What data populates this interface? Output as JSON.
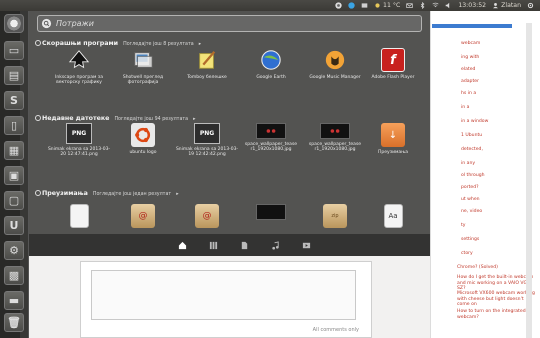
{
  "panel": {
    "temperature": "11 °C",
    "time": "13:03:52",
    "user": "Zlatan"
  },
  "search": {
    "placeholder": "Потражи"
  },
  "sections": {
    "recent_apps": {
      "title": "Скорашњи програми",
      "subtitle": "Погледајте још 8 резултата",
      "items": [
        {
          "label": "Inkscape програм за векторску графику",
          "icon": "inkscape-icon"
        },
        {
          "label": "Shotwell преглед фотографија",
          "icon": "shotwell-icon"
        },
        {
          "label": "Tomboy белешке",
          "icon": "tomboy-notes-icon"
        },
        {
          "label": "Google Earth",
          "icon": "google-earth-icon"
        },
        {
          "label": "Google Music Manager",
          "icon": "google-music-manager-icon"
        },
        {
          "label": "Adobe Flash Player",
          "icon": "flash-player-icon"
        }
      ]
    },
    "recent_files": {
      "title": "Недавне датотеке",
      "subtitle": "Погледајте још 94 резултата",
      "items": [
        {
          "label": "Snimak ekrana sa 2013-03-20 12:47:41.png",
          "icon": "png-file-icon",
          "thumb": "PNG"
        },
        {
          "label": "ubuntu logo",
          "icon": "ubuntu-logo-icon",
          "thumb": ""
        },
        {
          "label": "Snimak ekrana sa 2013-03-19 12:42:42.png",
          "icon": "png-file-icon",
          "thumb": "PNG"
        },
        {
          "label": "space_wallpaper_tease r1_1920x1080.jpg",
          "icon": "wallpaper-thumb-icon",
          "thumb": ""
        },
        {
          "label": "space_wallpaper_tease r1_1920x1080.jpg",
          "icon": "wallpaper-thumb-icon",
          "thumb": ""
        },
        {
          "label": "Преузимања",
          "icon": "downloads-folder-icon",
          "thumb": ""
        }
      ]
    },
    "downloads": {
      "title": "Преузимања",
      "subtitle": "Погледајте још један резултат"
    }
  },
  "browser": {
    "footer": "All comments only",
    "sidebar_links": [
      "webcam",
      "ing with",
      "elated",
      "adapter",
      "hs in a",
      "in a",
      "in a window",
      "1 Ubuntu",
      "detected,",
      "in any",
      "ol through",
      "ported?",
      "ut when",
      "ne, video",
      "ty",
      "settings",
      "ctory",
      "Chrome? (Solved)",
      "How do I get the built-in webcam and mic working on a VAIO VGN SZ?",
      "Microsoft VX600 webcam working with cheese but light doesn't come on",
      "How to turn on the integrated webcam?"
    ]
  },
  "colors": {
    "dash_bg": "#3c3c3a",
    "link_red": "#c0392b",
    "panel_bg": "#3b3a36"
  }
}
